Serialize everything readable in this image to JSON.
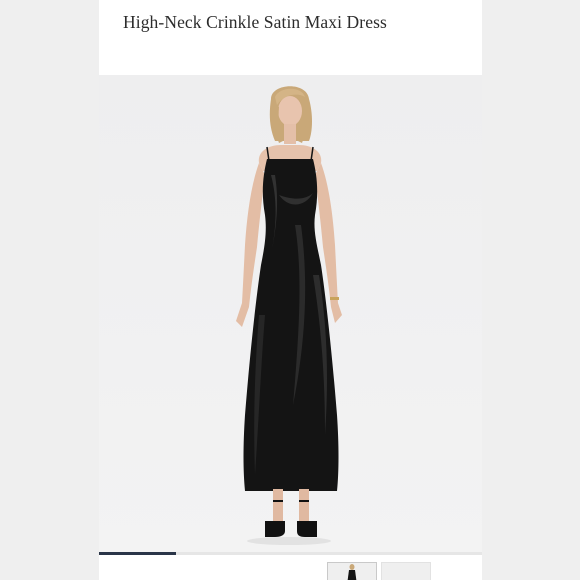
{
  "product": {
    "title": "High-Neck Crinkle Satin Maxi Dress"
  },
  "gallery": {
    "main_image": "model-wearing-black-satin-maxi-dress",
    "progress": 0.2,
    "thumbnails": [
      "dress-front-thumbnail",
      "dress-alt-thumbnail"
    ]
  },
  "colors": {
    "page_background": "#f0f0f0",
    "content_background": "#ffffff",
    "title_text": "#2c2c2c",
    "progress_indicator": "#2a3548",
    "dress": "#141414"
  }
}
